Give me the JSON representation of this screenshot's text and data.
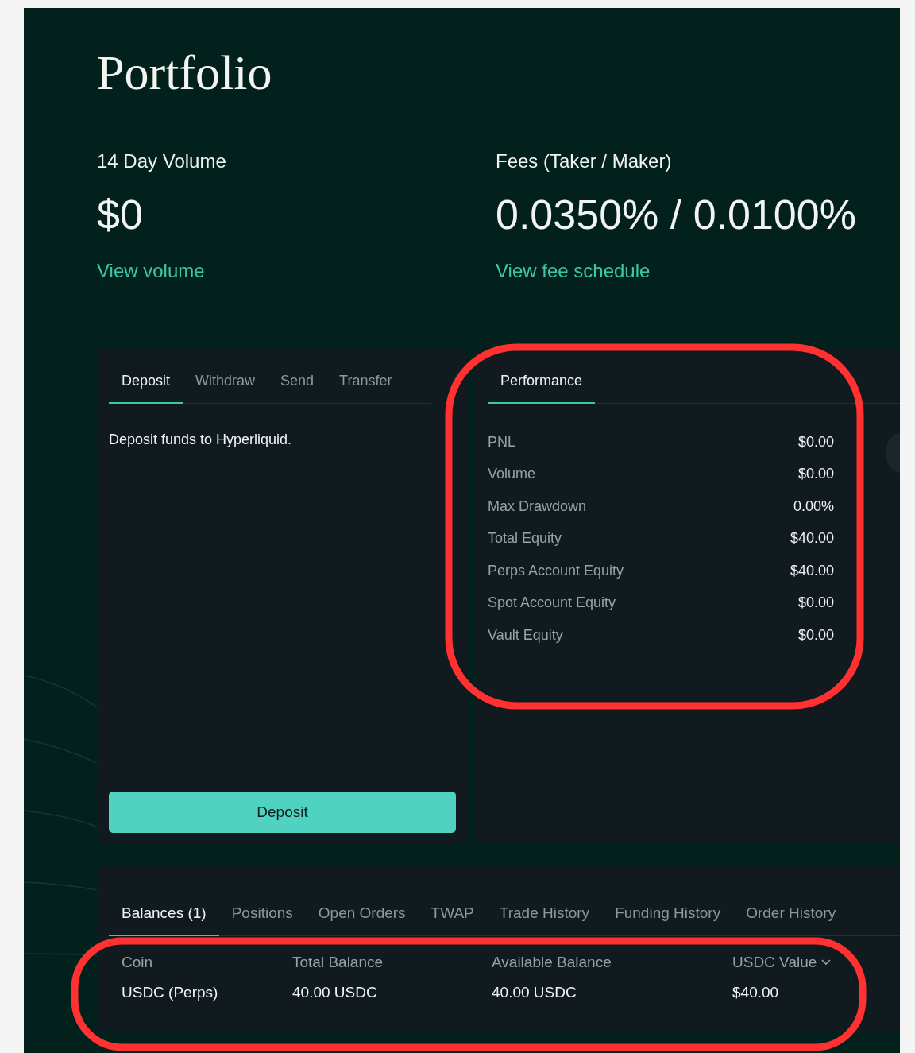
{
  "header": {
    "title": "Portfolio"
  },
  "stats": [
    {
      "label": "14 Day Volume",
      "value": "$0",
      "link": "View volume"
    },
    {
      "label": "Fees (Taker / Maker)",
      "value": "0.0350% / 0.0100%",
      "link": "View fee schedule"
    }
  ],
  "transfer_panel": {
    "tabs": [
      {
        "label": "Deposit",
        "selected": true
      },
      {
        "label": "Withdraw",
        "selected": false
      },
      {
        "label": "Send",
        "selected": false
      },
      {
        "label": "Transfer",
        "selected": false
      }
    ],
    "message": "Deposit funds to Hyperliquid.",
    "button": "Deposit"
  },
  "performance_panel": {
    "tabs": [
      {
        "label": "Performance",
        "selected": true
      }
    ],
    "rows": [
      {
        "label": "PNL",
        "value": "$0.00"
      },
      {
        "label": "Volume",
        "value": "$0.00"
      },
      {
        "label": "Max Drawdown",
        "value": "0.00%"
      },
      {
        "label": "Total Equity",
        "value": "$40.00"
      },
      {
        "label": "Perps Account Equity",
        "value": "$40.00"
      },
      {
        "label": "Spot Account Equity",
        "value": "$0.00"
      },
      {
        "label": "Vault Equity",
        "value": "$0.00"
      }
    ]
  },
  "account_panel": {
    "tabs": [
      {
        "label": "Balances (1)",
        "selected": true
      },
      {
        "label": "Positions",
        "selected": false
      },
      {
        "label": "Open Orders",
        "selected": false
      },
      {
        "label": "TWAP",
        "selected": false
      },
      {
        "label": "Trade History",
        "selected": false
      },
      {
        "label": "Funding History",
        "selected": false
      },
      {
        "label": "Order History",
        "selected": false
      }
    ],
    "table": {
      "columns": [
        {
          "label": "Coin",
          "sorted": false
        },
        {
          "label": "Total Balance",
          "sorted": false
        },
        {
          "label": "Available Balance",
          "sorted": false
        },
        {
          "label": "USDC Value",
          "sorted": true
        }
      ],
      "rows": [
        {
          "cells": [
            "USDC (Perps)",
            "40.00 USDC",
            "40.00 USDC",
            "$40.00"
          ]
        }
      ]
    }
  }
}
